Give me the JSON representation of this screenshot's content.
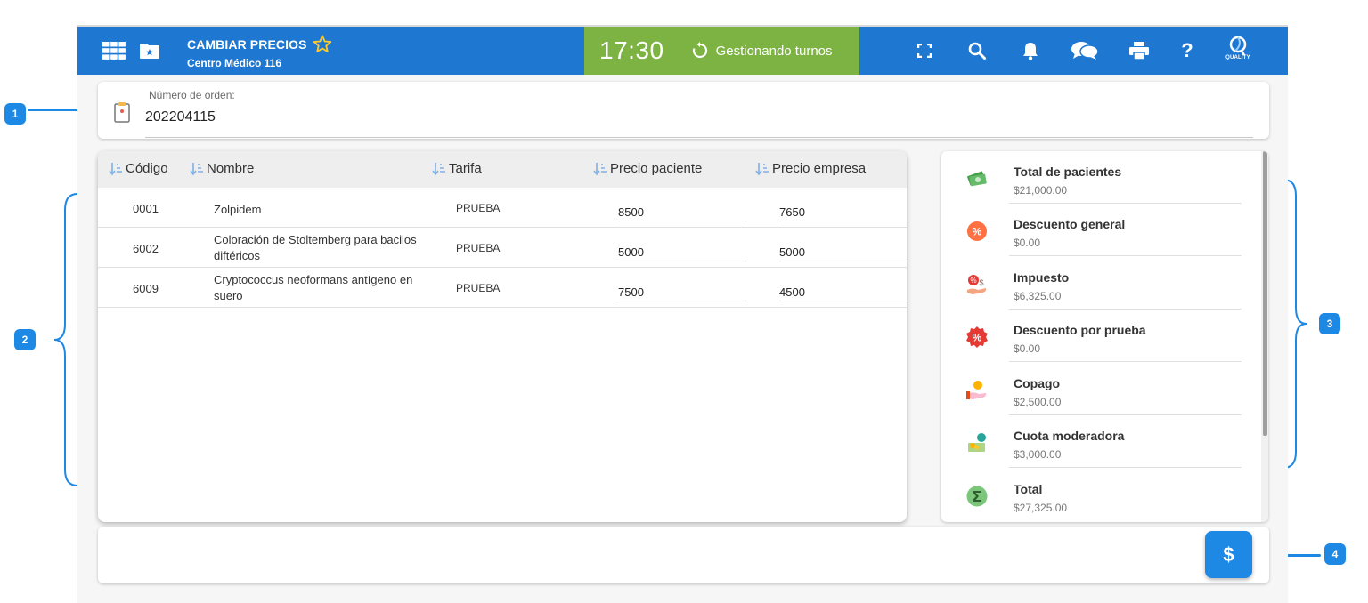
{
  "header": {
    "title": "CAMBIAR PRECIOS",
    "subtitle": "Centro Médico 116",
    "clock": "17:30",
    "status": "Gestionando turnos",
    "logo_text": "QUALITY",
    "icons": [
      "apps-grid-icon",
      "folder-star-icon",
      "star-outline-icon",
      "refresh-icon",
      "fullscreen-icon",
      "search-icon",
      "bell-icon",
      "chat-icon",
      "print-icon",
      "help-icon"
    ]
  },
  "order": {
    "label": "Número de orden:",
    "value": "202204115"
  },
  "table": {
    "headers": [
      "Código",
      "Nombre",
      "Tarifa",
      "Precio paciente",
      "Precio empresa"
    ],
    "rows": [
      {
        "codigo": "0001",
        "nombre": "Zolpidem",
        "tarifa": "PRUEBA",
        "precio_paciente": "8500",
        "precio_empresa": "7650"
      },
      {
        "codigo": "6002",
        "nombre": "Coloración de Stoltemberg para bacilos diftéricos",
        "tarifa": "PRUEBA",
        "precio_paciente": "5000",
        "precio_empresa": "5000"
      },
      {
        "codigo": "6009",
        "nombre": "Cryptococcus neoformans antígeno en suero",
        "tarifa": "PRUEBA",
        "precio_paciente": "7500",
        "precio_empresa": "4500"
      }
    ]
  },
  "summary": {
    "items": [
      {
        "label": "Total de pacientes",
        "value": "$21,000.00",
        "icon": "money-icon"
      },
      {
        "label": "Descuento general",
        "value": "$0.00",
        "icon": "percent-badge-icon"
      },
      {
        "label": "Impuesto",
        "value": "$6,325.00",
        "icon": "tax-hand-icon"
      },
      {
        "label": "Descuento por prueba",
        "value": "$0.00",
        "icon": "discount-seal-icon"
      },
      {
        "label": "Copago",
        "value": "$2,500.00",
        "icon": "coin-hand-icon"
      },
      {
        "label": "Cuota moderadora",
        "value": "$3,000.00",
        "icon": "cash-coin-icon"
      },
      {
        "label": "Total",
        "value": "$27,325.00",
        "icon": "sigma-icon"
      }
    ]
  },
  "footer": {
    "pay_label": "$"
  },
  "annotations": [
    "1",
    "2",
    "3",
    "4"
  ],
  "colors": {
    "primary": "#1e78d2",
    "clock_bg": "#7cb342",
    "accent": "#1e88e5",
    "star": "#ffca28"
  }
}
